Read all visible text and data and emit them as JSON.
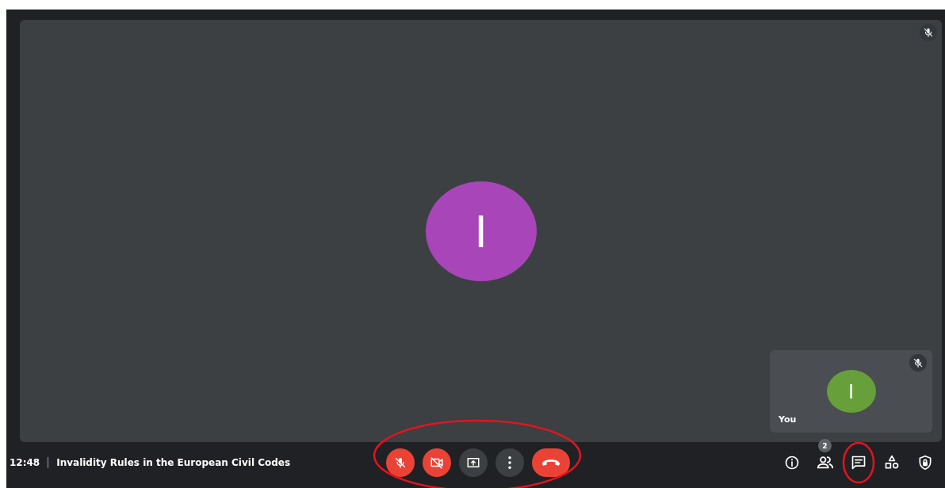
{
  "main_tile": {
    "initial": "I",
    "color": "#a846b9",
    "muted": true
  },
  "self_tile": {
    "initial": "I",
    "color": "#67a03a",
    "label": "You",
    "muted": true
  },
  "meeting": {
    "time": "12:48",
    "title": "Invalidity Rules in the European Civil Codes"
  },
  "controls": {
    "circled": true,
    "buttons": [
      {
        "kind": "mic",
        "on": false
      },
      {
        "kind": "camera",
        "on": false
      },
      {
        "kind": "present"
      },
      {
        "kind": "more"
      },
      {
        "kind": "hangup"
      }
    ]
  },
  "side_buttons": [
    {
      "kind": "info",
      "circled": false
    },
    {
      "kind": "people",
      "badge": "2",
      "circled": false
    },
    {
      "kind": "chat",
      "circled": true
    },
    {
      "kind": "activities",
      "circled": false
    },
    {
      "kind": "host",
      "circled": false
    }
  ]
}
